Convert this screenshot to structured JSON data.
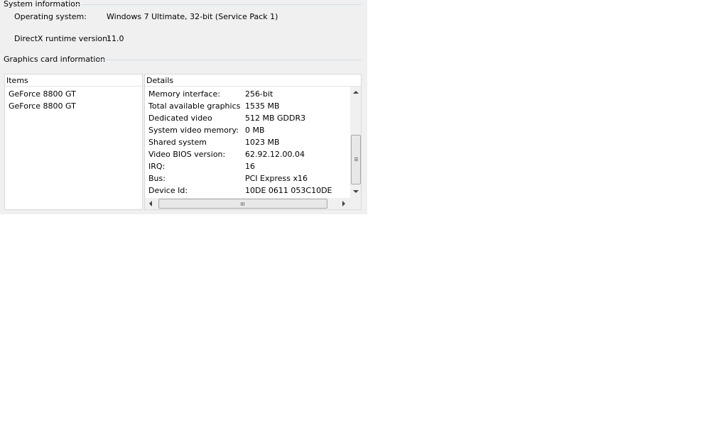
{
  "system_info": {
    "section_title": "System information",
    "rows": [
      {
        "label": "Operating system:",
        "value": "Windows 7 Ultimate, 32-bit (Service Pack 1)"
      },
      {
        "label": "DirectX runtime version:",
        "value": "11.0"
      }
    ]
  },
  "graphics_info": {
    "section_title": "Graphics card information",
    "items_header": "Items",
    "details_header": "Details",
    "items": [
      "GeForce 8800 GT",
      "GeForce 8800 GT"
    ],
    "details": [
      {
        "label": "Memory interface:",
        "value": "256-bit"
      },
      {
        "label": "Total available graphics ...",
        "value": "1535 MB"
      },
      {
        "label": "Dedicated video memory:",
        "value": "512 MB GDDR3"
      },
      {
        "label": "System video memory:",
        "value": "0 MB"
      },
      {
        "label": "Shared system memory:",
        "value": "1023 MB"
      },
      {
        "label": "Video BIOS version:",
        "value": "62.92.12.00.04"
      },
      {
        "label": "IRQ:",
        "value": "16"
      },
      {
        "label": "Bus:",
        "value": "PCI Express x16"
      },
      {
        "label": "Device Id:",
        "value": "10DE 0611 053C10DE"
      }
    ]
  },
  "icons": {
    "v_scroll_up": "scroll-up-arrow-icon",
    "v_scroll_down": "scroll-down-arrow-icon",
    "h_scroll_left": "scroll-left-arrow-icon",
    "h_scroll_right": "scroll-right-arrow-icon"
  }
}
